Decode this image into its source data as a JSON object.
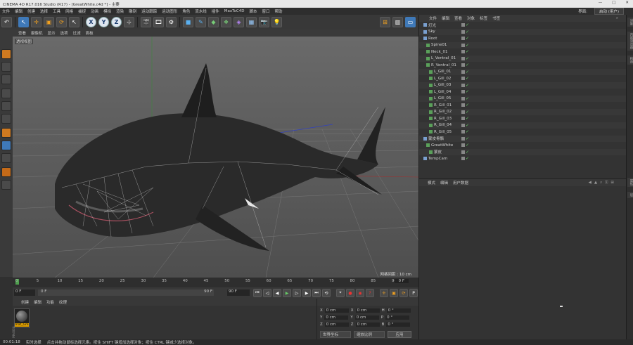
{
  "window": {
    "title": "CINEMA 4D R17.016 Studio (R17) - [GreatWhite.c4d *] - 主要",
    "controls": [
      "—",
      "□",
      "✕"
    ]
  },
  "menubar": {
    "items": [
      "文件",
      "编辑",
      "创建",
      "选择",
      "工具",
      "网格",
      "捕捉",
      "动画",
      "模拟",
      "渲染",
      "雕刻",
      "运动跟踪",
      "运动图形",
      "角色",
      "流水线",
      "插件",
      "MaxToC4D",
      "脚本",
      "窗口",
      "帮助"
    ],
    "layout_label": "界面:",
    "layout_value": "启动 (用户)"
  },
  "toolbar": {
    "axis_buttons": [
      "X",
      "Y",
      "Z"
    ],
    "icons": [
      "undo-icon",
      "select-icon",
      "move-icon",
      "scale-icon",
      "rotate-icon",
      "recent-icon",
      "x-axis-icon",
      "y-axis-icon",
      "z-axis-icon",
      "coord-system-icon",
      "render-view-icon",
      "render-picture-view-icon",
      "render-settings-icon",
      "cube-icon",
      "pen-icon",
      "subdivision-icon",
      "cloner-icon",
      "deformer-icon",
      "floor-icon",
      "camera-icon",
      "light-icon"
    ]
  },
  "viewport": {
    "menu": [
      "查看",
      "摄像机",
      "显示",
      "选项",
      "过滤",
      "面板"
    ],
    "label": "透视视图",
    "grid_spacing": "网格间距 : 10 cm"
  },
  "timeline": {
    "ticks": [
      "0",
      "5",
      "10",
      "15",
      "20",
      "25",
      "30",
      "35",
      "40",
      "45",
      "50",
      "55",
      "60",
      "65",
      "70",
      "75",
      "80",
      "85",
      "90"
    ],
    "end_frame": "0 F"
  },
  "transport": {
    "start": "0 F",
    "current": "0 F",
    "end_field": "90 F",
    "end_field2": "90 F"
  },
  "anim": {
    "menu": [
      "创建",
      "编辑",
      "功能",
      "纹理"
    ],
    "material_name": "mat_Gre"
  },
  "coords": {
    "rows": [
      {
        "a": "X",
        "av": "0 cm",
        "b": "X",
        "bv": "0 cm",
        "c": "H",
        "cv": "0 °"
      },
      {
        "a": "Y",
        "av": "0 cm",
        "b": "Y",
        "bv": "0 cm",
        "c": "P",
        "cv": "0 °"
      },
      {
        "a": "Z",
        "av": "0 cm",
        "b": "Z",
        "bv": "0 cm",
        "c": "B",
        "cv": "0 °"
      }
    ],
    "mode1": "世界坐标",
    "mode2": "缩放比例",
    "apply": "应用"
  },
  "status": {
    "time": "00:01:18",
    "mode": "实时选择",
    "hint": "点击并拖动鼠标选择元素。按住 SHIFT 键增加选择对象；按住 CTRL 键减少选择对象。"
  },
  "object_manager": {
    "menu": [
      "文件",
      "编辑",
      "查看",
      "对象",
      "标签",
      "书签"
    ],
    "objects": [
      {
        "name": "灯光",
        "indent": 0,
        "check": "✓"
      },
      {
        "name": "Sky",
        "indent": 0,
        "check": "✓"
      },
      {
        "name": "Root",
        "indent": 0,
        "check": "✓"
      },
      {
        "name": "Spine01",
        "indent": 1,
        "check": "✓"
      },
      {
        "name": "Neck_01",
        "indent": 1,
        "check": "✓"
      },
      {
        "name": "L_Ventral_01",
        "indent": 1,
        "check": "✓"
      },
      {
        "name": "R_Ventral_01",
        "indent": 1,
        "check": "✓"
      },
      {
        "name": "L_Gill_01",
        "indent": 2,
        "check": "✓"
      },
      {
        "name": "L_Gill_02",
        "indent": 2,
        "check": "✓"
      },
      {
        "name": "L_Gill_03",
        "indent": 2,
        "check": "✓"
      },
      {
        "name": "L_Gill_04",
        "indent": 2,
        "check": "✓"
      },
      {
        "name": "L_Gill_05",
        "indent": 2,
        "check": "✓"
      },
      {
        "name": "R_Gill_01",
        "indent": 2,
        "check": "✓"
      },
      {
        "name": "R_Gill_02",
        "indent": 2,
        "check": "✓"
      },
      {
        "name": "R_Gill_03",
        "indent": 2,
        "check": "✓"
      },
      {
        "name": "R_Gill_04",
        "indent": 2,
        "check": "✓"
      },
      {
        "name": "R_Gill_05",
        "indent": 2,
        "check": "✓"
      },
      {
        "name": "蒙皮骨骼",
        "indent": 0,
        "check": "✓"
      },
      {
        "name": "GreatWhite",
        "indent": 1,
        "check": "✓"
      },
      {
        "name": "蒙皮",
        "indent": 2,
        "check": "✓"
      },
      {
        "name": "TempCam",
        "indent": 0,
        "check": "✓"
      }
    ]
  },
  "attribute_manager": {
    "menu": [
      "模式",
      "编辑",
      "用户数据"
    ]
  },
  "side_tabs": [
    "对象",
    "内容浏览器",
    "构造",
    "属性",
    "层"
  ]
}
